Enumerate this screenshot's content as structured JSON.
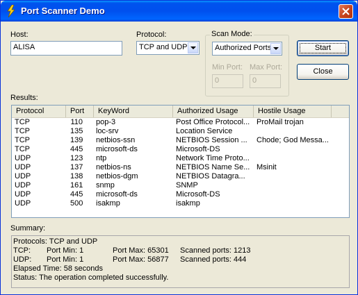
{
  "window": {
    "title": "Port Scanner Demo",
    "icon": "lightning-icon"
  },
  "host": {
    "label": "Host:",
    "value": "ALISA"
  },
  "protocol": {
    "label": "Protocol:",
    "selected": "TCP and UDP"
  },
  "scan_mode": {
    "label": "Scan Mode:",
    "selected": "Authorized Ports",
    "min_port_label": "Min Port:",
    "min_port_value": "0",
    "max_port_label": "Max Port:",
    "max_port_value": "0"
  },
  "buttons": {
    "start": "Start",
    "close": "Close"
  },
  "results": {
    "label": "Results:",
    "columns": [
      "Protocol",
      "Port",
      "KeyWord",
      "Authorized Usage",
      "Hostile Usage"
    ],
    "rows": [
      [
        "TCP",
        "110",
        "pop-3",
        "Post Office Protocol...",
        "ProMail trojan"
      ],
      [
        "TCP",
        "135",
        "loc-srv",
        "Location Service",
        ""
      ],
      [
        "TCP",
        "139",
        "netbios-ssn",
        "NETBIOS Session ...",
        "Chode; God Messa..."
      ],
      [
        "TCP",
        "445",
        "microsoft-ds",
        "Microsoft-DS",
        ""
      ],
      [
        "UDP",
        "123",
        "ntp",
        "Network Time Proto...",
        ""
      ],
      [
        "UDP",
        "137",
        "netbios-ns",
        "NETBIOS Name Se...",
        "Msinit"
      ],
      [
        "UDP",
        "138",
        "netbios-dgm",
        "NETBIOS Datagra...",
        ""
      ],
      [
        "UDP",
        "161",
        "snmp",
        "SNMP",
        ""
      ],
      [
        "UDP",
        "445",
        "microsoft-ds",
        "Microsoft-DS",
        ""
      ],
      [
        "UDP",
        "500",
        "isakmp",
        "isakmp",
        ""
      ]
    ]
  },
  "summary": {
    "label": "Summary:",
    "protocols": "Protocols: TCP and UDP",
    "tcp": {
      "label": "TCP:",
      "min": "Port Min: 1",
      "max": "Port Max: 65301",
      "scanned": "Scanned ports: 1213"
    },
    "udp": {
      "label": "UDP:",
      "min": "Port Min: 1",
      "max": "Port Max: 56877",
      "scanned": "Scanned ports: 444"
    },
    "elapsed": "Elapsed Time: 58 seconds",
    "status": "Status: The operation completed successfully."
  }
}
